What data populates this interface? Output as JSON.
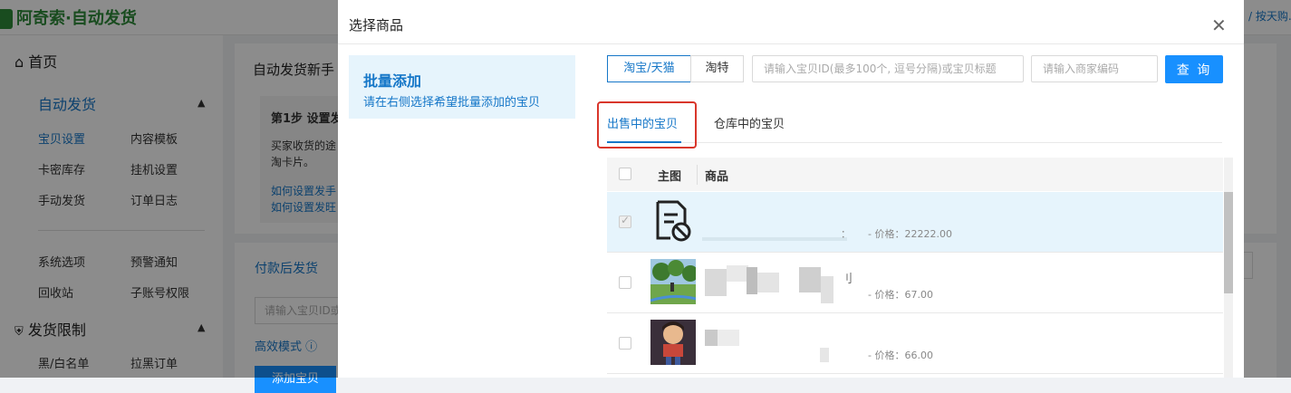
{
  "app": {
    "title": "阿奇索·自动发货",
    "topright_text": "/ 按天购..."
  },
  "sidebar": {
    "home": "首页",
    "sections": [
      {
        "label": "自动发货",
        "items": [
          "宝贝设置",
          "内容模板",
          "卡密库存",
          "挂机设置",
          "手动发货",
          "订单日志",
          "系统选项",
          "预警通知",
          "回收站",
          "子账号权限"
        ]
      },
      {
        "label": "发货限制",
        "items": [
          "黑/白名单",
          "拉黑订单"
        ]
      }
    ]
  },
  "background": {
    "guide_title": "自动发货新手",
    "step_title": "第1步 设置发",
    "step_text_1": "买家收货的途",
    "step_text_2": "淘卡片。",
    "link_1": "如何设置发手",
    "link_2": "如何设置发旺",
    "tab_paid": "付款后发货",
    "input_placeholder": "请输入宝贝ID或",
    "efficient_mode": "高效模式",
    "add_button": "添加宝贝"
  },
  "modal": {
    "title": "选择商品",
    "close_icon": "close-icon",
    "batch": {
      "title": "批量添加",
      "subtitle": "请在右侧选择希望批量添加的宝贝"
    },
    "platforms": [
      "淘宝/天猫",
      "淘特"
    ],
    "active_platform": "淘宝/天猫",
    "search": {
      "id_placeholder": "请输入宝贝ID(最多100个, 逗号分隔)或宝贝标题",
      "code_placeholder": "请输入商家编码",
      "button": "查 询"
    },
    "tabs": [
      "出售中的宝贝",
      "仓库中的宝贝"
    ],
    "active_tab": "出售中的宝贝",
    "table": {
      "headers": [
        "主图",
        "商品"
      ],
      "rows": [
        {
          "checked": true,
          "disabled": true,
          "thumb": "no-image-icon",
          "name_tail": "：",
          "price": "-  价格：22222.00"
        },
        {
          "checked": false,
          "disabled": false,
          "thumb": "product-photo",
          "name_tail": "刂",
          "price": "-  价格：67.00"
        },
        {
          "checked": false,
          "disabled": false,
          "thumb": "product-photo",
          "name_tail": "",
          "price": "-  价格：66.00"
        }
      ]
    },
    "colors": {
      "accent": "#1890ff",
      "highlight_row": "#e6f4fc",
      "annotation_red": "#d9362b"
    }
  }
}
